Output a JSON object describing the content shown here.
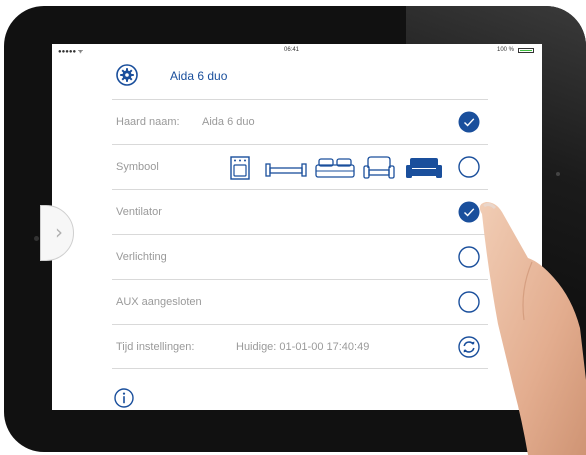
{
  "status_bar": {
    "carrier": "●●●●● ᯤ",
    "time": "06:41",
    "battery_text": "100 %"
  },
  "header": {
    "title": "Aida 6 duo",
    "icon": "gear-icon"
  },
  "rows": [
    {
      "label": "Haard naam:",
      "value": "Aida 6 duo",
      "control": "checkbox",
      "checked": true
    },
    {
      "label": "Symbool",
      "control": "radio",
      "checked": false,
      "symbols": [
        "stove-icon",
        "bench-icon",
        "bed-icon",
        "armchair-icon",
        "sofa-icon"
      ],
      "selected_symbol": "sofa-icon"
    },
    {
      "label": "Ventilator",
      "control": "checkbox",
      "checked": true
    },
    {
      "label": "Verlichting",
      "control": "checkbox",
      "checked": false
    },
    {
      "label": "AUX aangesloten",
      "control": "checkbox",
      "checked": false
    },
    {
      "label": "Tijd instellingen:",
      "value": "Huidige: 01-01-00 17:40:49",
      "control": "refresh"
    }
  ],
  "footer": {
    "icon": "info-icon"
  },
  "colors": {
    "accent": "#1a4f9c",
    "label": "#9a9a9a",
    "divider": "#d9d9d9",
    "bezel": "#111111"
  }
}
